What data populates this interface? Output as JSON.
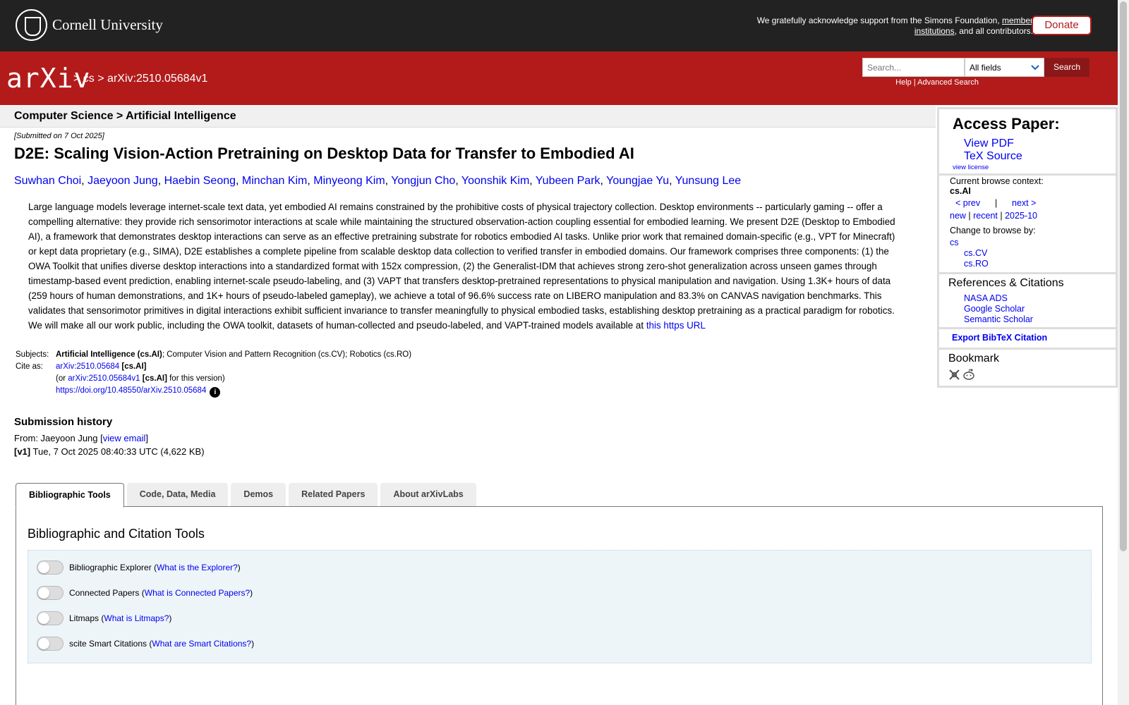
{
  "cornell": {
    "name": "Cornell University",
    "ack_prefix": "We gratefully acknowledge support from the Simons Foundation, ",
    "ack_link1": "member institutions",
    "ack_suffix": ", and all contributors.",
    "donate": "Donate"
  },
  "header": {
    "logo": "arXiv",
    "crumb_sep1": ">",
    "crumb_cs": "cs",
    "crumb_sep2": ">",
    "crumb_id": "arXiv:2510.05684v1",
    "search_placeholder": "Search...",
    "search_field": "All fields",
    "search_button": "Search",
    "help": "Help",
    "advanced": "Advanced Search"
  },
  "subheader": "Computer Science > Artificial Intelligence",
  "paper": {
    "submitted": "[Submitted on 7 Oct 2025]",
    "title": "D2E: Scaling Vision-Action Pretraining on Desktop Data for Transfer to Embodied AI",
    "authors": [
      "Suwhan Choi",
      "Jaeyoon Jung",
      "Haebin Seong",
      "Minchan Kim",
      "Minyeong Kim",
      "Yongjun Cho",
      "Yoonshik Kim",
      "Yubeen Park",
      "Youngjae Yu",
      "Yunsung Lee"
    ],
    "abstract": "Large language models leverage internet-scale text data, yet embodied AI remains constrained by the prohibitive costs of physical trajectory collection. Desktop environments -- particularly gaming -- offer a compelling alternative: they provide rich sensorimotor interactions at scale while maintaining the structured observation-action coupling essential for embodied learning. We present D2E (Desktop to Embodied AI), a framework that demonstrates desktop interactions can serve as an effective pretraining substrate for robotics embodied AI tasks. Unlike prior work that remained domain-specific (e.g., VPT for Minecraft) or kept data proprietary (e.g., SIMA), D2E establishes a complete pipeline from scalable desktop data collection to verified transfer in embodied domains. Our framework comprises three components: (1) the OWA Toolkit that unifies diverse desktop interactions into a standardized format with 152x compression, (2) the Generalist-IDM that achieves strong zero-shot generalization across unseen games through timestamp-based event prediction, enabling internet-scale pseudo-labeling, and (3) VAPT that transfers desktop-pretrained representations to physical manipulation and navigation. Using 1.3K+ hours of data (259 hours of human demonstrations, and 1K+ hours of pseudo-labeled gameplay), we achieve a total of 96.6% success rate on LIBERO manipulation and 83.3% on CANVAS navigation benchmarks. This validates that sensorimotor primitives in digital interactions exhibit sufficient invariance to transfer meaningfully to physical embodied tasks, establishing desktop pretraining as a practical paradigm for robotics. We will make all our work public, including the OWA toolkit, datasets of human-collected and pseudo-labeled, and VAPT-trained models available at ",
    "abstract_link": "this https URL",
    "subjects_label": "Subjects:",
    "subjects_primary": "Artificial Intelligence (cs.AI)",
    "subjects_rest": "; Computer Vision and Pattern Recognition (cs.CV); Robotics (cs.RO)",
    "cite_label": "Cite as:",
    "cite_id": "arXiv:2510.05684",
    "cite_cat": "[cs.AI]",
    "cite_or": "(or ",
    "cite_v1": "arXiv:2510.05684v1",
    "cite_v1_cat": "[cs.AI]",
    "cite_v1_suffix": " for this version)",
    "doi": "https://doi.org/10.48550/arXiv.2510.05684",
    "info_glyph": "i"
  },
  "history": {
    "title": "Submission history",
    "from_prefix": "From: Jaeyoon Jung [",
    "view_email": "view email",
    "from_suffix": "]",
    "v1_label": "[v1]",
    "v1_text": " Tue, 7 Oct 2025 08:40:33 UTC (4,622 KB)"
  },
  "tabs": [
    "Bibliographic Tools",
    "Code, Data, Media",
    "Demos",
    "Related Papers",
    "About arXivLabs"
  ],
  "tools": {
    "title": "Bibliographic and Citation Tools",
    "items": [
      {
        "label": "Bibliographic Explorer",
        "link": "What is the Explorer?"
      },
      {
        "label": "Connected Papers",
        "link": "What is Connected Papers?"
      },
      {
        "label": "Litmaps",
        "link": "What is Litmaps?"
      },
      {
        "label": "scite Smart Citations",
        "link": "What are Smart Citations?"
      }
    ]
  },
  "sidebar": {
    "access_title": "Access Paper:",
    "view_pdf": "View PDF",
    "tex_source": "TeX Source",
    "view_license": "view license",
    "context_label": "Current browse context:",
    "context_value": "cs.AI",
    "prev": "< prev",
    "sep": "|",
    "next": "next >",
    "new": "new",
    "recent": "recent",
    "month": "2025-10",
    "change_label": "Change to browse by:",
    "browse_cs": "cs",
    "browse_cv": "cs.CV",
    "browse_ro": "cs.RO",
    "refs_title": "References & Citations",
    "nasa": "NASA ADS",
    "google": "Google Scholar",
    "semantic": "Semantic Scholar",
    "bibtex": "Export BibTeX Citation",
    "bookmark": "Bookmark"
  }
}
